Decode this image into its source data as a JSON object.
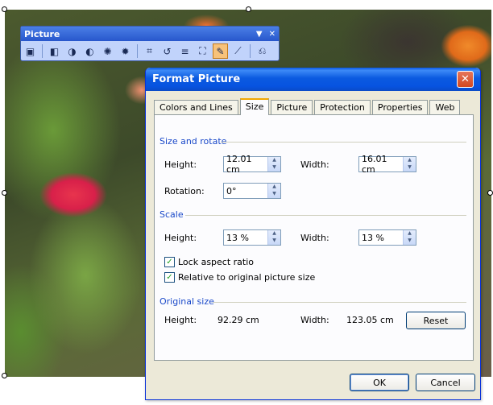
{
  "toolbar": {
    "title": "Picture",
    "dropdown_glyph": "▼",
    "close_glyph": "✕",
    "buttons": [
      {
        "icon": "insert-picture-icon",
        "glyph": "▣"
      },
      {
        "icon": "color-icon",
        "glyph": "◧"
      },
      {
        "icon": "more-contrast-icon",
        "glyph": "◑"
      },
      {
        "icon": "less-contrast-icon",
        "glyph": "◐"
      },
      {
        "icon": "more-brightness-icon",
        "glyph": "✺"
      },
      {
        "icon": "less-brightness-icon",
        "glyph": "✹"
      },
      {
        "icon": "crop-icon",
        "glyph": "⌗"
      },
      {
        "icon": "rotate-icon",
        "glyph": "↺"
      },
      {
        "icon": "line-style-icon",
        "glyph": "≡"
      },
      {
        "icon": "compress-icon",
        "glyph": "⛶"
      },
      {
        "icon": "format-picture-icon",
        "glyph": "✎"
      },
      {
        "icon": "set-transparent-color-icon",
        "glyph": "⟋"
      },
      {
        "icon": "reset-picture-icon",
        "glyph": "⎌"
      }
    ]
  },
  "dialog": {
    "title": "Format Picture",
    "close_glyph": "✕",
    "tabs": [
      "Colors and Lines",
      "Size",
      "Picture",
      "Protection",
      "Properties",
      "Web"
    ],
    "active_tab": "Size",
    "size_rotate": {
      "section": "Size and rotate",
      "height_label": "Height:",
      "height_value": "12.01 cm",
      "width_label": "Width:",
      "width_value": "16.01 cm",
      "rotation_label": "Rotation:",
      "rotation_value": "0°"
    },
    "scale": {
      "section": "Scale",
      "height_label": "Height:",
      "height_value": "13 %",
      "width_label": "Width:",
      "width_value": "13 %",
      "lock_aspect_label": "Lock aspect ratio",
      "lock_aspect_checked": true,
      "relative_label": "Relative to original picture size",
      "relative_checked": true
    },
    "original": {
      "section": "Original size",
      "height_label": "Height:",
      "height_value": "92.29 cm",
      "width_label": "Width:",
      "width_value": "123.05 cm",
      "reset_label": "Reset"
    },
    "ok_label": "OK",
    "cancel_label": "Cancel"
  },
  "colors": {
    "title_blue": "#0753e0",
    "section_blue": "#1a49c9",
    "tab_highlight": "#f1a700",
    "dialog_face": "#ece9d8"
  }
}
